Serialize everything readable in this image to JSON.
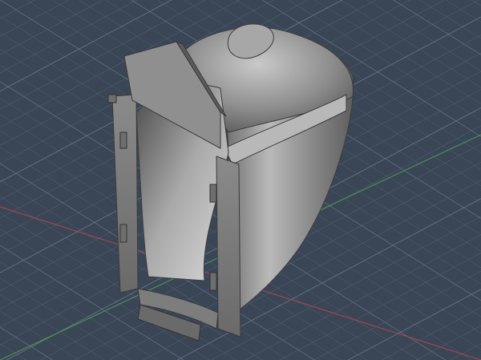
{
  "viewport": {
    "type": "3d-cad-viewport",
    "projection": "isometric",
    "background_color": "#3a4656",
    "grid": {
      "visible": true,
      "minor_color": "#566577",
      "major_color": "#6a7a8d"
    },
    "axes": {
      "x_color": "#b0474d",
      "y_color": "#4f9a56"
    }
  },
  "model": {
    "description_icon": "sectioned-part-icon",
    "shading": "gray-shaded",
    "base_color": "#9a9a9a",
    "highlight_color": "#d4d4d4",
    "shadow_color": "#555555"
  }
}
